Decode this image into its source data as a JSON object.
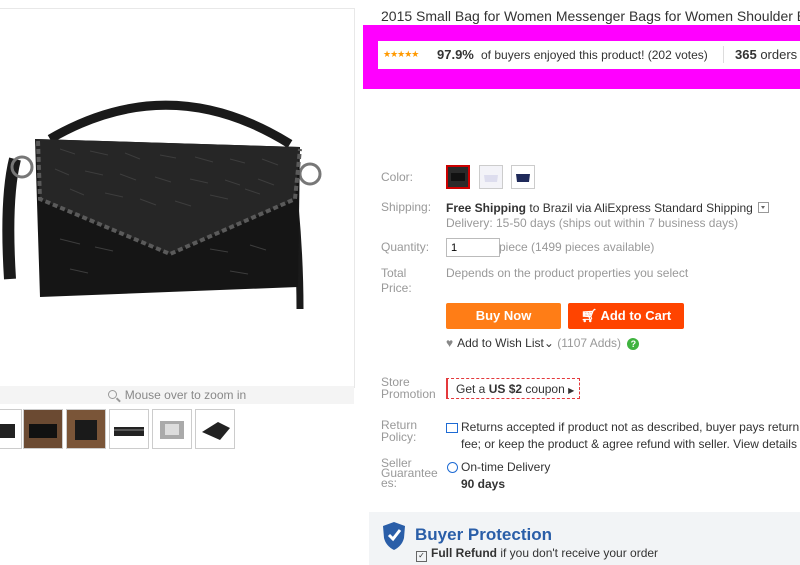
{
  "product": {
    "title": "2015 Small Bag for Women Messenger Bags for Women Shoulder B",
    "zoom_hint": "Mouse over to zoom in",
    "thumbnail_count": 6
  },
  "rating": {
    "stars": "★★★★★",
    "percent": "97.9%",
    "text": "of buyers enjoyed this product! (202 votes)",
    "orders_count": "365",
    "orders_label": "orders"
  },
  "options": {
    "color_label": "Color:",
    "shipping_label": "Shipping:",
    "shipping_free": "Free Shipping",
    "shipping_to": "to",
    "shipping_dest": "Brazil via AliExpress Standard Shipping",
    "delivery": "Delivery: 15-50 days (ships out within 7 business days)",
    "quantity_label": "Quantity:",
    "quantity_value": "1",
    "quantity_unit": "piece (1499 pieces available)",
    "total_label_1": "Total",
    "total_label_2": "Price:",
    "total_value": "Depends on the product properties you select"
  },
  "actions": {
    "buy_now": "Buy Now",
    "add_to_cart": "Add to Cart",
    "wish_list": "Add to Wish List",
    "wish_adds": "(1107 Adds)"
  },
  "promotion": {
    "label_1": "Store",
    "label_2": "Promotion",
    "coupon_pre": "Get a",
    "coupon_amount": "US $2",
    "coupon_post": "coupon"
  },
  "return_policy": {
    "label_1": "Return",
    "label_2": "Policy:",
    "line1": "Returns accepted if product not as described, buyer pays return",
    "line2": "fee; or keep the product & agree refund with seller. View details"
  },
  "guarantee": {
    "label_1": "Seller",
    "label_2": "Guarantee",
    "label_3": "es:",
    "title": "On-time Delivery",
    "days": "90 days"
  },
  "buyer_protection": {
    "title": "Buyer Protection",
    "item_bold": "Full Refund",
    "item_rest": "if you don't receive your order"
  },
  "colors": {
    "highlight": "#ff00ff",
    "buy_now": "#ff7d16",
    "add_to_cart": "#ff4400",
    "star": "#ff9900",
    "protection": "#2a5ea8"
  }
}
